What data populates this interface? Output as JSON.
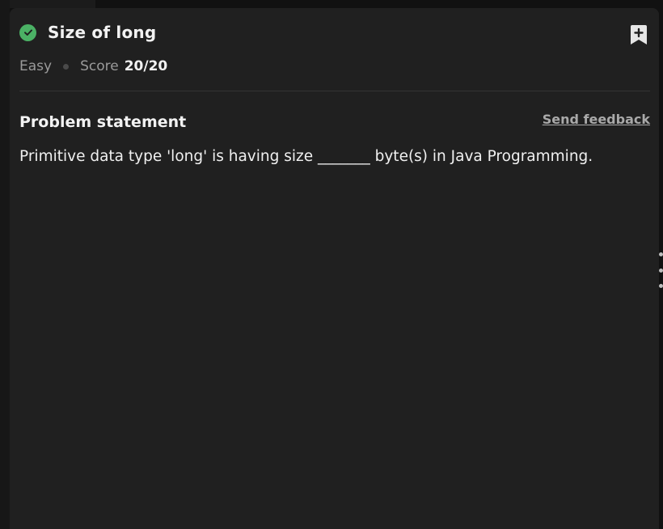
{
  "problem": {
    "title": "Size of long",
    "difficulty": "Easy",
    "score_label": "Score",
    "score_value": "20/20",
    "status_icon": "check-circle-icon",
    "bookmark_icon": "bookmark-plus-icon"
  },
  "section": {
    "title": "Problem statement",
    "feedback_label": "Send feedback",
    "statement": "Primitive data type 'long' is having size _______ byte(s) in Java Programming."
  },
  "colors": {
    "success": "#4bb165",
    "background": "#202020",
    "text": "#f2f2f2",
    "muted": "#9a9a9a"
  }
}
